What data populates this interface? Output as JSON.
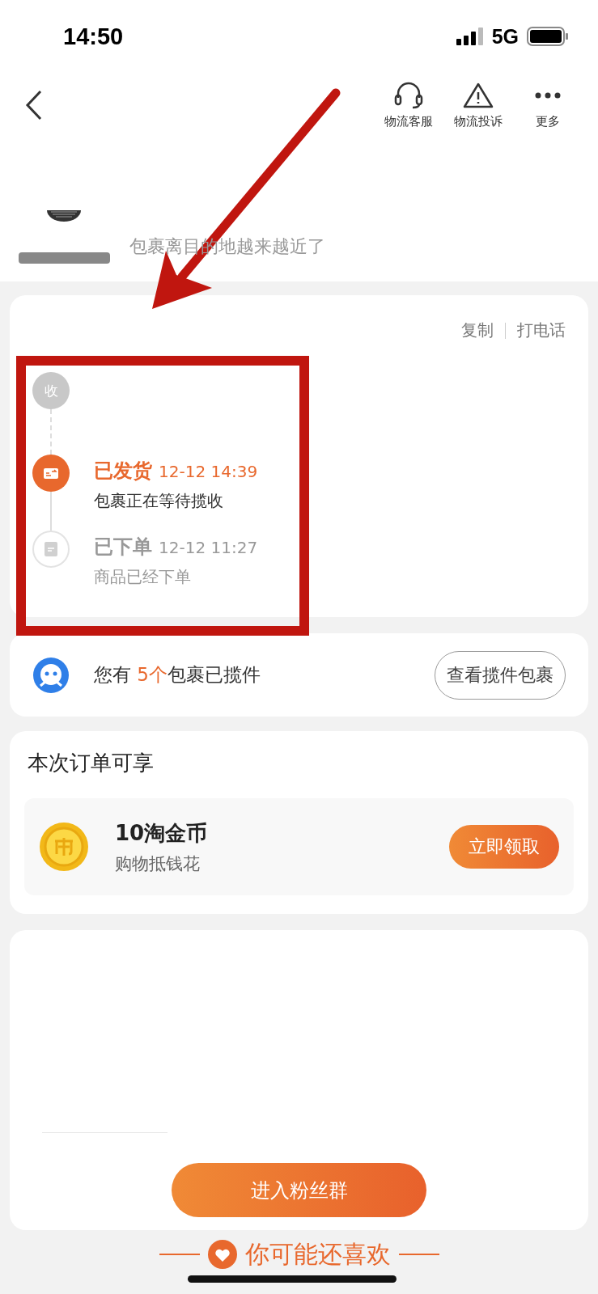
{
  "status_bar": {
    "time": "14:50",
    "network": "5G"
  },
  "header": {
    "actions": [
      {
        "kind": "headset",
        "label": "物流客服"
      },
      {
        "kind": "warning",
        "label": "物流投诉"
      },
      {
        "kind": "more",
        "label": "更多"
      }
    ]
  },
  "product": {
    "message": "包裹离目的地越来越近了"
  },
  "tracking": {
    "actions": [
      "复制",
      "打电话"
    ],
    "steps": [
      {
        "kind": "pending",
        "badge": "收"
      },
      {
        "kind": "current",
        "title": "已发货",
        "time": "12-12 14:39",
        "detail": "包裹正在等待揽收"
      },
      {
        "kind": "done",
        "title": "已下单",
        "time": "12-12 11:27",
        "detail": "商品已经下单"
      }
    ]
  },
  "parcels": {
    "prefix": "您有",
    "count": "5个",
    "suffix": "包裹已揽件",
    "button": "查看揽件包裹"
  },
  "rewards": {
    "title": "本次订单可享",
    "item": {
      "name": "10淘金币",
      "subtitle": "购物抵钱花",
      "button": "立即领取"
    }
  },
  "fan_group": {
    "button": "进入粉丝群"
  },
  "recommend": {
    "title": "你可能还喜欢"
  },
  "annotation": {
    "arrow": true,
    "frame": true
  }
}
